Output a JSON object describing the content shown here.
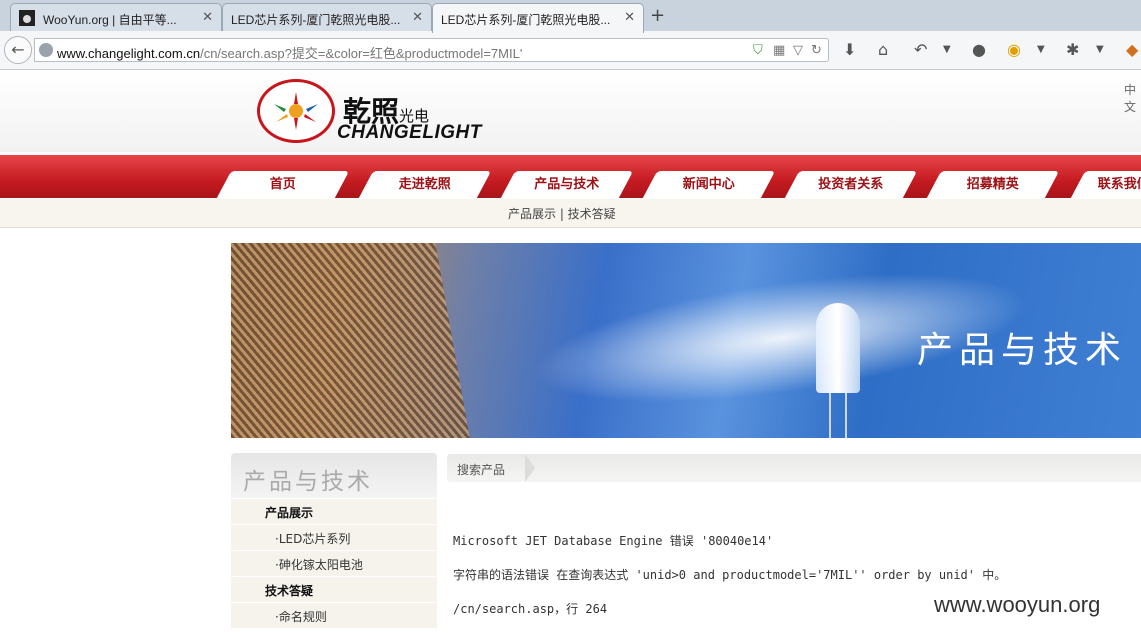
{
  "browser": {
    "tabs": [
      {
        "title": "WooYun.org | 自由平等...",
        "active": false
      },
      {
        "title": "LED芯片系列-厦门乾照光电股...",
        "active": false
      },
      {
        "title": "LED芯片系列-厦门乾照光电股...",
        "active": true
      }
    ],
    "new_tab_label": "+",
    "url_host": "www.changelight.com.cn",
    "url_path": "/cn/search.asp?提交=&color=红色&productmodel=7MIL'"
  },
  "header": {
    "logo_cn": "乾照",
    "logo_cn_small": "光电",
    "logo_en": "CHANGELIGHT",
    "lang": "中文"
  },
  "nav": {
    "items": [
      "首页",
      "走进乾照",
      "产品与技术",
      "新闻中心",
      "投资者关系",
      "招募精英",
      "联系我们"
    ]
  },
  "subnav": {
    "text": "产品展示 | 技术答疑"
  },
  "banner": {
    "title": "产品与技术"
  },
  "sidebar": {
    "title": "产品与技术",
    "items": [
      {
        "label": "产品展示",
        "type": "cat"
      },
      {
        "label": "·LED芯片系列",
        "type": "sub"
      },
      {
        "label": "·砷化镓太阳电池",
        "type": "sub"
      },
      {
        "label": "技术答疑",
        "type": "cat"
      },
      {
        "label": "·命名规则",
        "type": "sub"
      }
    ]
  },
  "content": {
    "crumb": "搜索产品",
    "error_line1": "Microsoft JET Database Engine 错误 '80040e14'",
    "error_line2": "字符串的语法错误 在查询表达式 'unid>0 and productmodel='7MIL'' order by unid' 中。",
    "error_line3": "/cn/search.asp，行 264"
  },
  "watermark": "www.wooyun.org",
  "colors": {
    "brand_red": "#c41b21",
    "nav_text": "#9b1116"
  }
}
